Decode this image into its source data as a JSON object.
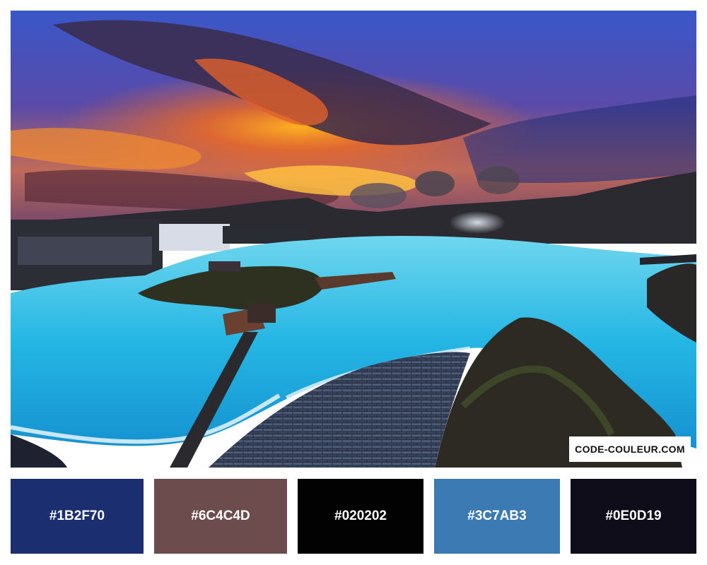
{
  "watermark": "CODE-COULEUR.COM",
  "palette": [
    {
      "hex": "#1B2F70",
      "color": "#1B2F70"
    },
    {
      "hex": "#6C4C4D",
      "color": "#6C4C4D"
    },
    {
      "hex": "#020202",
      "color": "#020202"
    },
    {
      "hex": "#3C7AB3",
      "color": "#3C7AB3"
    },
    {
      "hex": "#0E0D19",
      "color": "#0E0D19"
    }
  ]
}
